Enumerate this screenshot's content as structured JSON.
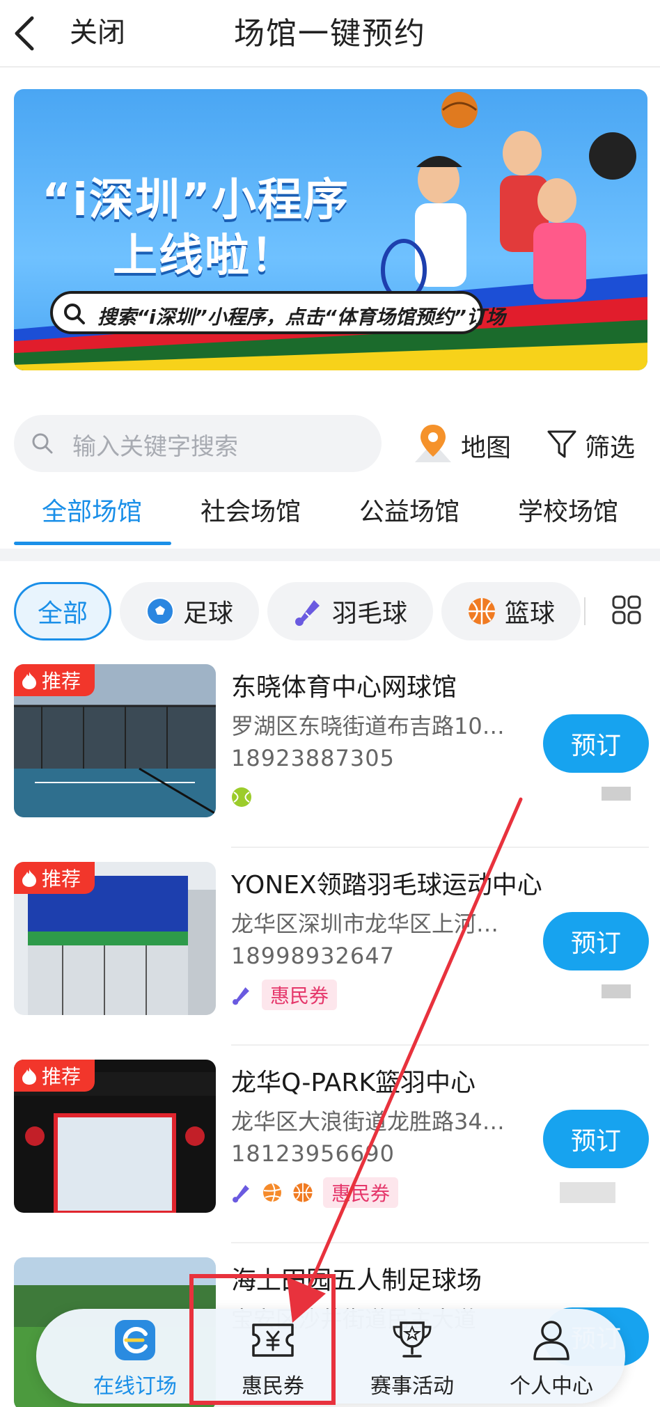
{
  "header": {
    "close_label": "关闭",
    "title": "场馆一键预约"
  },
  "banner": {
    "headline_line1": "“i深圳”小程序",
    "headline_line2": "上线啦！",
    "search_hint": "搜索“i深圳”小程序，点击“体育场馆预约”订场",
    "page_count": 6,
    "active_page": 2
  },
  "search": {
    "placeholder": "输入关键字搜索",
    "map_label": "地图",
    "filter_label": "筛选"
  },
  "tabs": [
    {
      "label": "全部场馆",
      "active": true
    },
    {
      "label": "社会场馆",
      "active": false
    },
    {
      "label": "公益场馆",
      "active": false
    },
    {
      "label": "学校场馆",
      "active": false
    }
  ],
  "categories": [
    {
      "label": "全部",
      "icon": "none",
      "active": true
    },
    {
      "label": "足球",
      "icon": "soccer-ball-icon",
      "active": false
    },
    {
      "label": "羽毛球",
      "icon": "shuttlecock-icon",
      "active": false
    },
    {
      "label": "篮球",
      "icon": "basketball-icon",
      "active": false
    }
  ],
  "venues": [
    {
      "tag": "推荐",
      "name": "东晓体育中心网球馆",
      "address": "罗湖区东晓街道布吉路10…",
      "phone": "18923887305",
      "sports": [
        "tennis-ball-icon"
      ],
      "coupon": "",
      "book_label": "预订"
    },
    {
      "tag": "推荐",
      "name": "YONEX领踏羽毛球运动中心",
      "address": "龙华区深圳市龙华区上河…",
      "phone": "18998932647",
      "sports": [
        "shuttlecock-icon"
      ],
      "coupon": "惠民券",
      "book_label": "预订"
    },
    {
      "tag": "推荐",
      "name": "龙华Q-PARK篮羽中心",
      "address": "龙华区大浪街道龙胜路34…",
      "phone": "18123956690",
      "sports": [
        "shuttlecock-icon",
        "volleyball-icon",
        "basketball-icon"
      ],
      "coupon": "惠民券",
      "book_label": "预订"
    },
    {
      "tag": "",
      "name": "海上田园五人制足球场",
      "address": "宝安区沙井街道民主大道",
      "phone": "",
      "sports": [],
      "coupon": "",
      "book_label": "预订"
    }
  ],
  "bottom_nav": [
    {
      "label": "在线订场",
      "icon": "venue-logo-icon",
      "active": true
    },
    {
      "label": "惠民券",
      "icon": "ticket-yen-icon",
      "active": false
    },
    {
      "label": "赛事活动",
      "icon": "trophy-icon",
      "active": false
    },
    {
      "label": "个人中心",
      "icon": "person-icon",
      "active": false
    }
  ],
  "colors": {
    "accent": "#1a8fe8",
    "book_button": "#17a3ef",
    "recommend_tag": "#f2362b",
    "coupon_text": "#e5366a",
    "annotation_red": "#e8323d"
  }
}
